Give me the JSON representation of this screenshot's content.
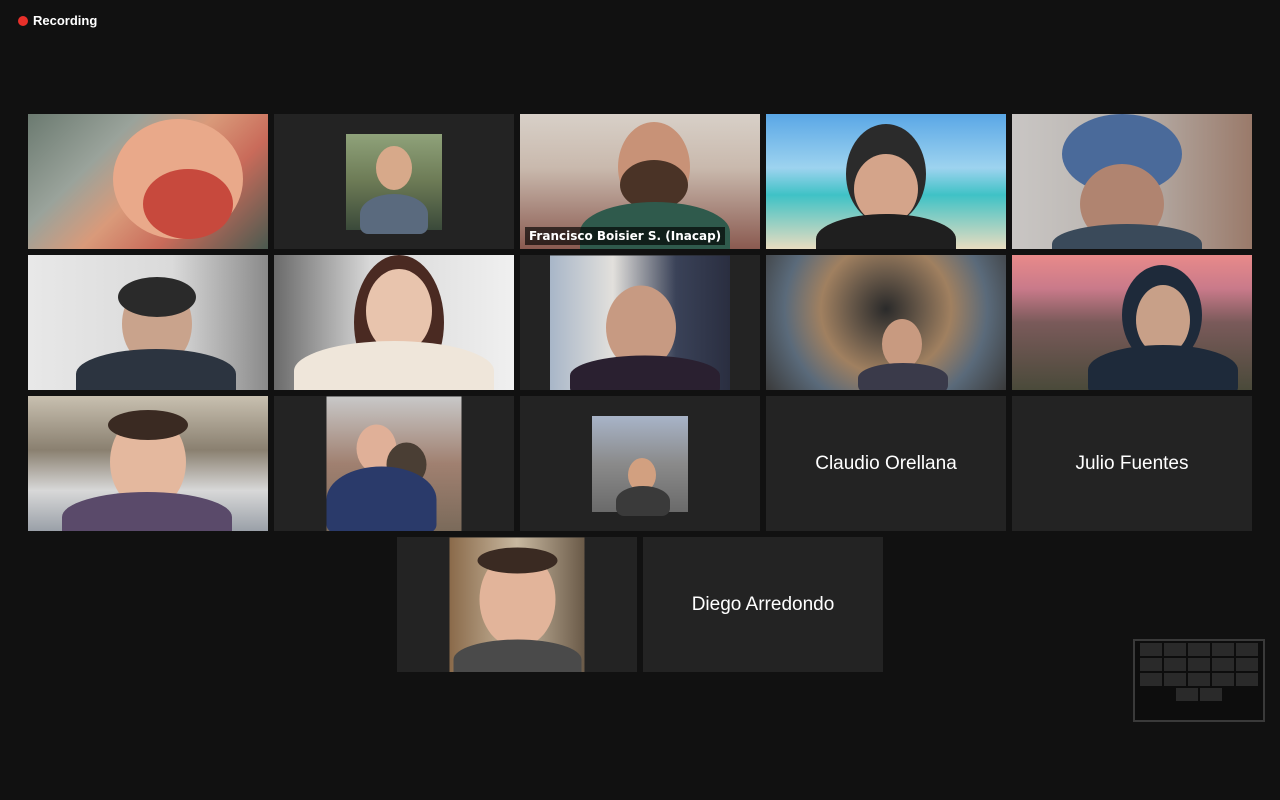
{
  "recording": {
    "label": "Recording",
    "dot_color": "#e8302a"
  },
  "active_speaker_color": "#e4e88a",
  "participants": {
    "p1": {
      "icon": "cat-filter-video"
    },
    "p2": {
      "icon": "profile-photo"
    },
    "p3": {
      "name": "Francisco Boisier S. (Inacap)"
    },
    "p4": {
      "icon": "beach-background-video"
    },
    "p5": {
      "icon": "beanie-video"
    },
    "p6": {
      "icon": "headset-video"
    },
    "p7": {
      "icon": "smiling-video"
    },
    "p8": {
      "icon": "brick-wall-video"
    },
    "p9": {
      "icon": "particle-collider-background-video"
    },
    "p10": {
      "icon": "city-hills-background-video"
    },
    "p11": {
      "icon": "office-background-video"
    },
    "p12": {
      "icon": "dog-profile-photo"
    },
    "p13": {
      "icon": "city-view-profile-photo"
    },
    "p14": {
      "name": "Claudio Orellana"
    },
    "p15": {
      "name": "Julio Fuentes"
    },
    "p16": {
      "icon": "profile-photo"
    },
    "p17": {
      "name": "Diego Arredondo"
    }
  }
}
